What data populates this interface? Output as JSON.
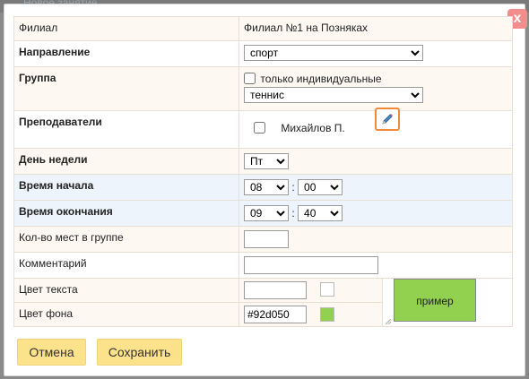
{
  "background": {
    "faint_text": "Новое занятие"
  },
  "dialog": {
    "close_label": "x",
    "branch": {
      "label": "Филиал",
      "value": "Филиал №1 на Позняках"
    },
    "direction": {
      "label": "Направление",
      "selected": "спорт"
    },
    "group": {
      "label": "Группа",
      "individual_only_label": "только индивидуальные",
      "individual_only_checked": false,
      "selected": "теннис"
    },
    "teachers": {
      "label": "Преподаватели",
      "items": [
        {
          "name": "Михайлов П.",
          "checked": false
        }
      ],
      "edit_icon": "pencil-icon"
    },
    "weekday": {
      "label": "День недели",
      "selected": "Пт"
    },
    "start_time": {
      "label": "Время начала",
      "hour": "08",
      "minute": "00",
      "separator": ":"
    },
    "end_time": {
      "label": "Время окончания",
      "hour": "09",
      "minute": "40",
      "separator": ":"
    },
    "capacity": {
      "label": "Кол-во мест в группе",
      "value": ""
    },
    "comment": {
      "label": "Комментарий",
      "value": ""
    },
    "text_color": {
      "label": "Цвет текста",
      "value": "",
      "swatch": "#ffffff"
    },
    "bg_color": {
      "label": "Цвет фона",
      "value": "#92d050",
      "swatch": "#92d050"
    },
    "preview": {
      "label": "пример",
      "bg": "#92d050"
    },
    "buttons": {
      "cancel": "Отмена",
      "save": "Сохранить"
    }
  },
  "colors": {
    "button_bg": "#fde28c",
    "pencil_border": "#ee8a3a",
    "close_bg": "#f28d8d"
  }
}
